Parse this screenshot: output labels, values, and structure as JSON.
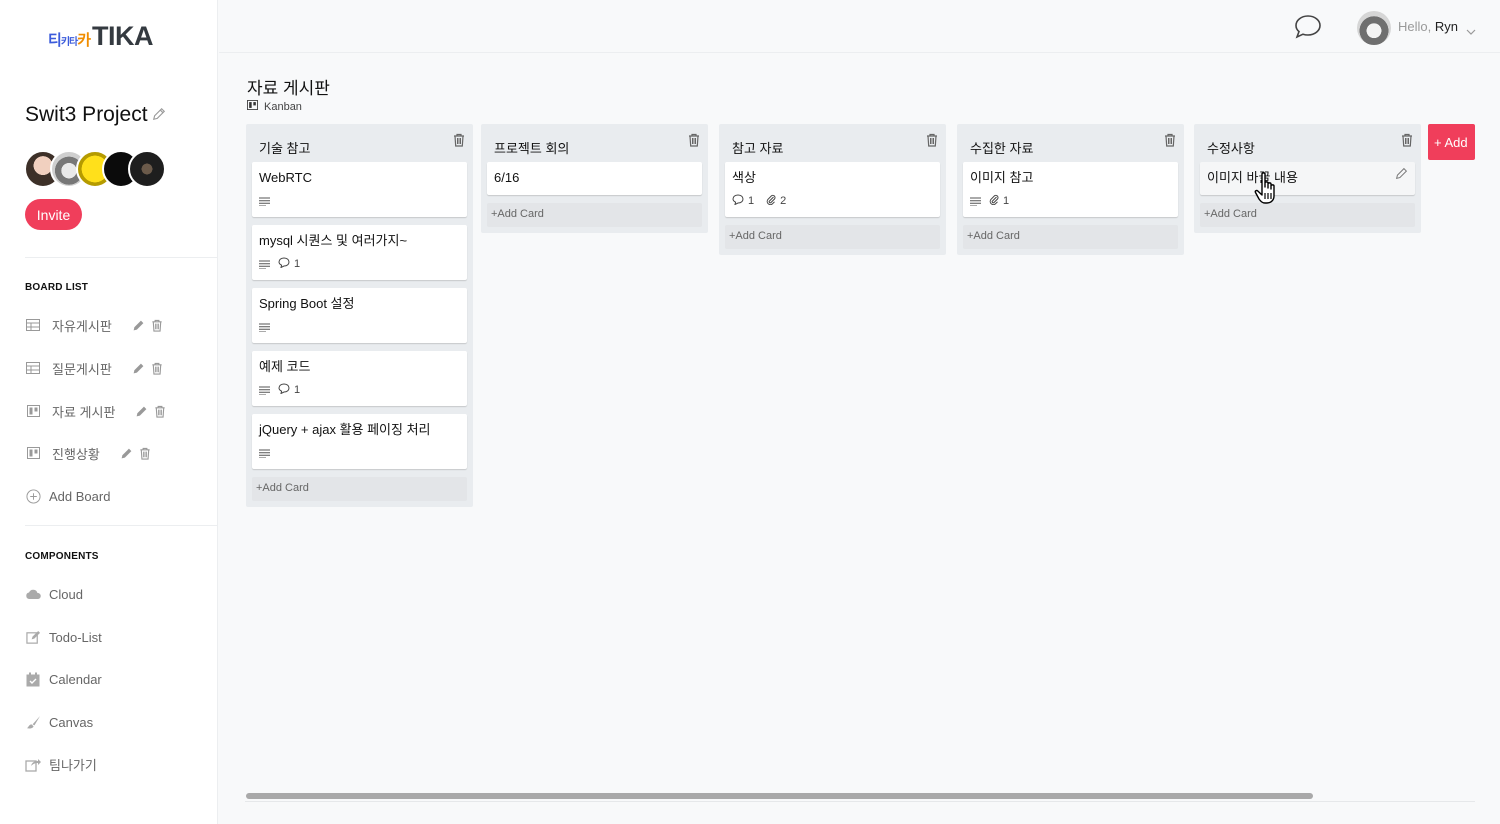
{
  "sidebar": {
    "logo": {
      "korean_a": "티",
      "korean_b": "키타",
      "korean_c": "카",
      "text": "TIKA"
    },
    "project": {
      "title": "Swit3 Project"
    },
    "invite_label": "Invite",
    "board_list_label": "BOARD LIST",
    "boards": [
      {
        "label": "자유게시판",
        "icon": "table-icon"
      },
      {
        "label": "질문게시판",
        "icon": "table-icon"
      },
      {
        "label": "자료 게시판",
        "icon": "kanban-icon"
      },
      {
        "label": "진행상황",
        "icon": "kanban-icon"
      }
    ],
    "add_board_label": "Add Board",
    "components_label": "COMPONENTS",
    "components": [
      {
        "label": "Cloud",
        "icon": "cloud-icon"
      },
      {
        "label": "Todo-List",
        "icon": "edit-icon"
      },
      {
        "label": "Calendar",
        "icon": "calendar-icon"
      },
      {
        "label": "Canvas",
        "icon": "brush-icon"
      },
      {
        "label": "팀나가기",
        "icon": "exit-icon"
      }
    ]
  },
  "header": {
    "hello_prefix": "Hello,",
    "user_name": "Ryn"
  },
  "board": {
    "title": "자료 게시판",
    "type_label": "Kanban"
  },
  "columns": [
    {
      "title": "기술 참고",
      "cards": [
        {
          "title": "WebRTC",
          "has_description": true
        },
        {
          "title": "mysql 시퀀스 및 여러가지~",
          "has_description": true,
          "comments": "1"
        },
        {
          "title": "Spring Boot 설정",
          "has_description": true
        },
        {
          "title": "예제 코드",
          "has_description": true,
          "comments": "1"
        },
        {
          "title": "jQuery + ajax 활용 페이징 처리",
          "has_description": true
        }
      ],
      "add_card_label": "+Add Card"
    },
    {
      "title": "프로젝트 회의",
      "cards": [
        {
          "title": "6/16"
        }
      ],
      "add_card_label": "+Add Card"
    },
    {
      "title": "참고 자료",
      "cards": [
        {
          "title": "색상",
          "comments": "1",
          "attachments": "2"
        }
      ],
      "add_card_label": "+Add Card"
    },
    {
      "title": "수집한 자료",
      "cards": [
        {
          "title": "이미지 참고",
          "has_description": true,
          "attachments": "1"
        }
      ],
      "add_card_label": "+Add Card"
    },
    {
      "title": "수정사항",
      "cards": [
        {
          "title": "이미지 바꿀 내용",
          "editing": true
        }
      ],
      "add_card_label": "+Add Card"
    }
  ],
  "add_list_label": "+ Add",
  "colors": {
    "accent": "#f03e5b",
    "column_bg": "#e9ecef",
    "logo_blue": "#3b5bdb",
    "logo_orange": "#f08c00"
  }
}
